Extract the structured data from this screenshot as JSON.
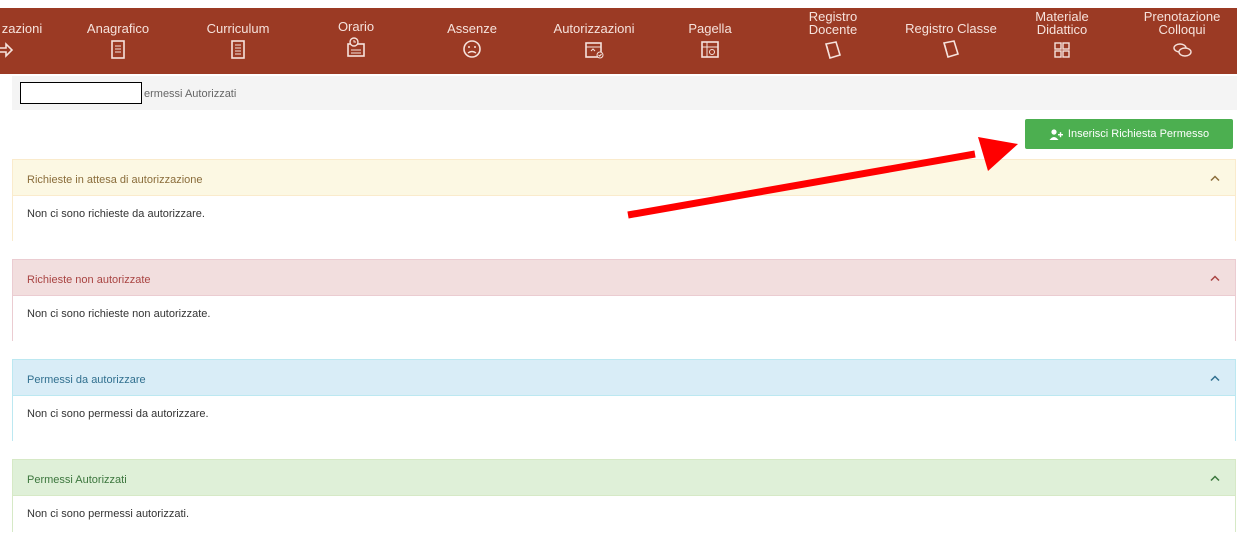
{
  "nav": [
    {
      "label": "zazioni",
      "icon": "arrow-icon"
    },
    {
      "label": "Anagrafico",
      "icon": "id-card-icon"
    },
    {
      "label": "Curriculum",
      "icon": "document-icon"
    },
    {
      "label": "Orario",
      "icon": "calendar-clock-icon"
    },
    {
      "label": "Assenze",
      "icon": "sad-face-icon"
    },
    {
      "label": "Autorizzazioni",
      "icon": "calendar-check-icon"
    },
    {
      "label": "Pagella",
      "icon": "report-card-icon"
    },
    {
      "label_line1": "Registro",
      "label_line2": "Docente",
      "icon": "book-icon"
    },
    {
      "label": "Registro Classe",
      "icon": "book-icon"
    },
    {
      "label_line1": "Materiale",
      "label_line2": "Didattico",
      "icon": "puzzle-icon"
    },
    {
      "label_line1": "Prenotazione",
      "label_line2": "Colloqui",
      "icon": "chat-icon"
    }
  ],
  "breadcrumb": {
    "current": "ermessi Autorizzati"
  },
  "add_button": {
    "label": "Inserisci Richiesta Permesso",
    "icon": "user-add-icon"
  },
  "panels": [
    {
      "title": "Richieste in attesa di autorizzazione",
      "message": "Non ci sono richieste da autorizzare.",
      "color": "#fcf8e3",
      "border": "#faebcc",
      "text": "#8a6d3b"
    },
    {
      "title": "Richieste non autorizzate",
      "message": "Non ci sono richieste non autorizzate.",
      "color": "#f2dede",
      "border": "#ebccd1",
      "text": "#a94442"
    },
    {
      "title": "Permessi da autorizzare",
      "message": "Non ci sono permessi da autorizzare.",
      "color": "#d9edf7",
      "border": "#bce8f1",
      "text": "#31708f"
    },
    {
      "title": "Permessi Autorizzati",
      "message": "Non ci sono permessi autorizzati.",
      "color": "#dff0d8",
      "border": "#d6e9c6",
      "text": "#3c763d"
    }
  ],
  "colors": {
    "nav_bg": "#9b3a24",
    "button_bg": "#4caf50",
    "annotation_arrow": "#ff0000"
  }
}
